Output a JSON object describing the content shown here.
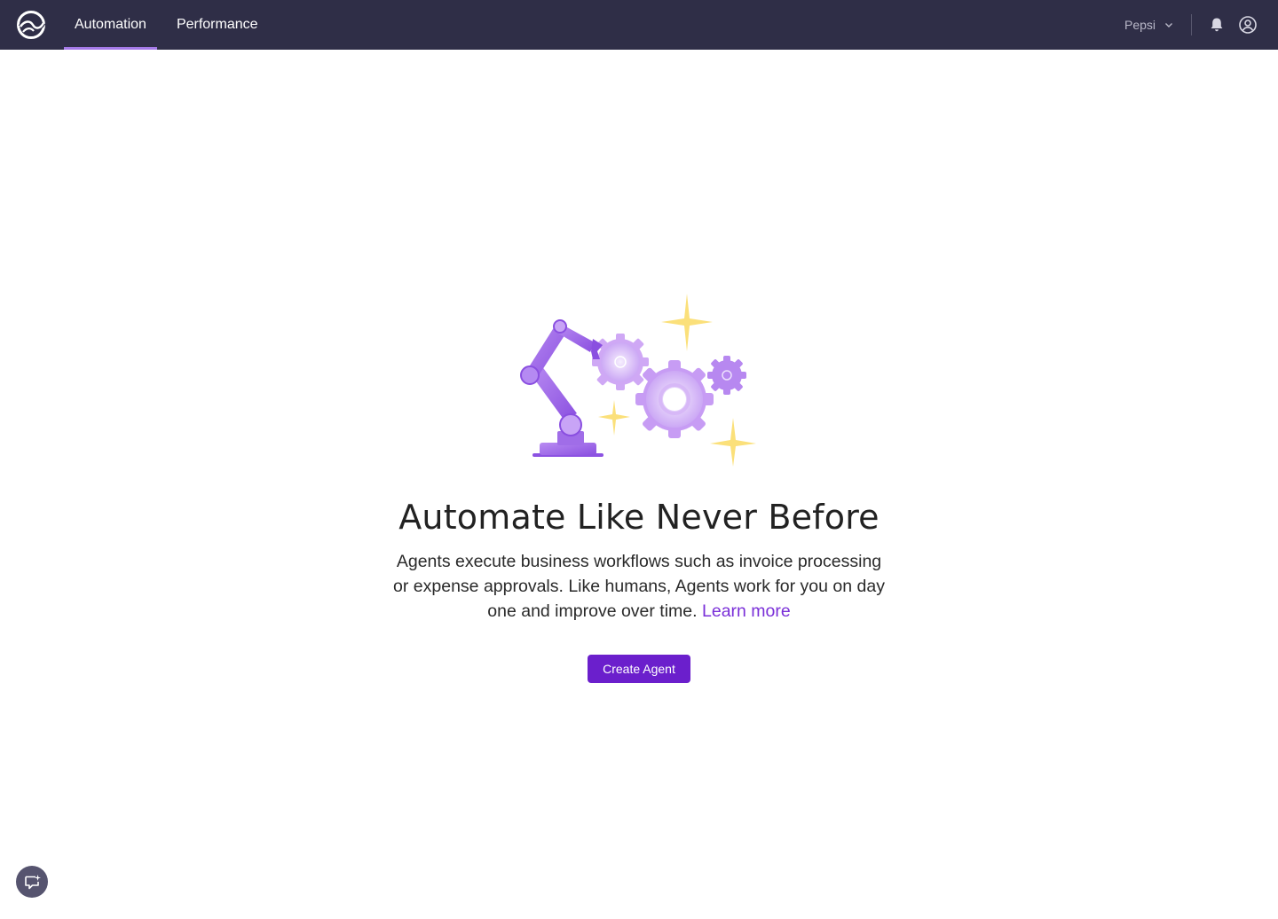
{
  "app": {
    "nav_tabs": [
      {
        "label": "Automation",
        "active": true
      },
      {
        "label": "Performance",
        "active": false
      }
    ],
    "org_selector": {
      "value": "Pepsi"
    },
    "icons": {
      "logo": "logo-icon",
      "chevron": "chevron-down-icon",
      "bell": "bell-icon",
      "profile": "user-circle-icon",
      "chat": "chat-sparkle-icon"
    }
  },
  "empty_state": {
    "title": "Automate Like Never Before",
    "description": "Agents execute business workflows such as invoice processing or expense approvals.  Like humans, Agents work for you on day one and improve over time.",
    "learn_more": "Learn more",
    "cta_label": "Create Agent"
  },
  "colors": {
    "topbar_bg": "#2f2e47",
    "accent": "#6b1fcc",
    "active_tab_underline": "#a57ae8",
    "link": "#7a2fd8",
    "sparkle": "#fbe07a"
  }
}
